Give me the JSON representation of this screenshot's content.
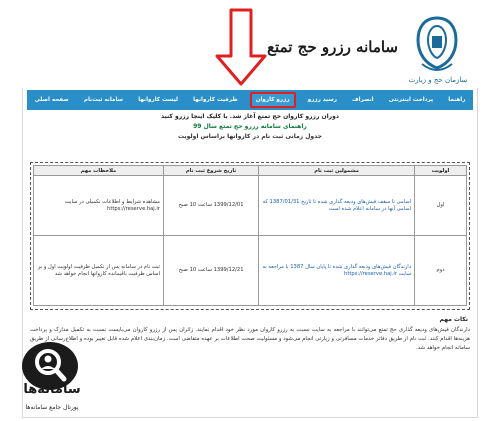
{
  "header": {
    "site_title": "سامانه رزرو حج تمتع",
    "logo_caption": "سازمان حج و زیارت"
  },
  "nav": {
    "items": [
      {
        "label": "صفحه اصلی",
        "active": false
      },
      {
        "label": "سامانه ثبت‌نام",
        "active": false
      },
      {
        "label": "لیست کاروانها",
        "active": false
      },
      {
        "label": "ظرفیت کاروانها",
        "active": false
      },
      {
        "label": "رزرو کاروان",
        "active": true
      },
      {
        "label": "رسید رزرو",
        "active": false
      },
      {
        "label": "انصراف",
        "active": false
      },
      {
        "label": "پرداخت اینترنتی",
        "active": false
      },
      {
        "label": "راهنما",
        "active": false
      }
    ]
  },
  "notice": {
    "line1": "دوران رزرو کاروان حج تمتع آغاز شد. با کلیک اینجا رزرو کنید",
    "line2": "راهنمای سامانه رزرو حج تمتع سال 99",
    "line3": "جدول زمانی ثبت نام در کاروانها براساس اولویت"
  },
  "table": {
    "headers": [
      "اولویت",
      "مشمولین ثبت نام",
      "تاریخ شروع ثبت نام",
      "ملاحظات مهم"
    ],
    "rows": [
      {
        "priority": "اول",
        "eligible": "اسامی تا سقف فیش‌های ودیعه گذاری شده تا تاریخ 1387/01/31 که اسامی آنها در سامانه اعلام شده است",
        "start": "1399/12/01 ساعت 10 صبح",
        "notes": "مشاهده شرایط و اطلاعات تکمیلی در سایت https://reserve.haj.ir"
      },
      {
        "priority": "دوم",
        "eligible": "دارندگان فیش‌های ودیعه گذاری شده تا پایان سال 1387 با مراجعه به سایت https://reserve.haj.ir",
        "start": "1399/12/21 ساعت 10 صبح",
        "notes": "ثبت نام در سامانه پس از تکمیل ظرفیت اولویت اول و بر اساس ظرفیت باقیمانده کاروانها انجام خواهد شد"
      }
    ]
  },
  "notes": {
    "title": "نکات مهم",
    "text": "دارندگان فیش‌های ودیعه گذاری حج تمتع می‌توانند با مراجعه به سایت نسبت به رزرو کاروان مورد نظر خود اقدام نمایند. زائران پس از رزرو کاروان می‌بایست نسبت به تکمیل مدارک و پرداخت هزینه‌ها اقدام کنند. ثبت نام از طریق دفاتر خدمات مسافرتی و زیارتی انجام می‌شود و مسئولیت صحت اطلاعات بر عهده متقاضی است. زمان‌بندی اعلام شده قابل تغییر بوده و اطلاع‌رسانی از طریق سامانه انجام خواهد شد."
  },
  "watermark": {
    "text": "سامانه‌ها",
    "subtitle": "پورتال جامع سامانه‌ها"
  },
  "colors": {
    "nav": "#2a8ec9",
    "active_border": "#e02020",
    "arrow": "#e02020",
    "link_green": "#0b7a3a"
  }
}
